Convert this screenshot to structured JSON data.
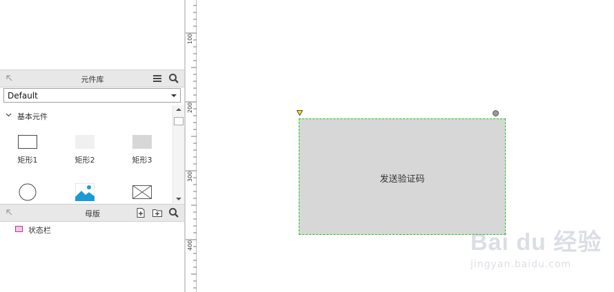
{
  "library_panel": {
    "title": "元件库",
    "selected_library": "Default",
    "group_label": "基本元件",
    "widgets": [
      {
        "label": "矩形1",
        "icon": "rectangle-white-icon"
      },
      {
        "label": "矩形2",
        "icon": "rectangle-light-gray-icon"
      },
      {
        "label": "矩形3",
        "icon": "rectangle-gray-icon"
      },
      {
        "label": "",
        "icon": "ellipse-icon"
      },
      {
        "label": "",
        "icon": "image-icon"
      },
      {
        "label": "",
        "icon": "placeholder-icon"
      }
    ]
  },
  "masters_panel": {
    "title": "母版",
    "items": [
      {
        "label": "状态栏",
        "icon": "master-icon"
      }
    ]
  },
  "ruler": {
    "labels": [
      "100",
      "200",
      "300",
      "400"
    ]
  },
  "canvas": {
    "shape_text": "发送验证码",
    "shape_fill": "#d7d7d7",
    "selection_color": "#19c319"
  },
  "watermark": {
    "line1": "Bai du 经验",
    "line2": "jingyan.baidu.com"
  }
}
